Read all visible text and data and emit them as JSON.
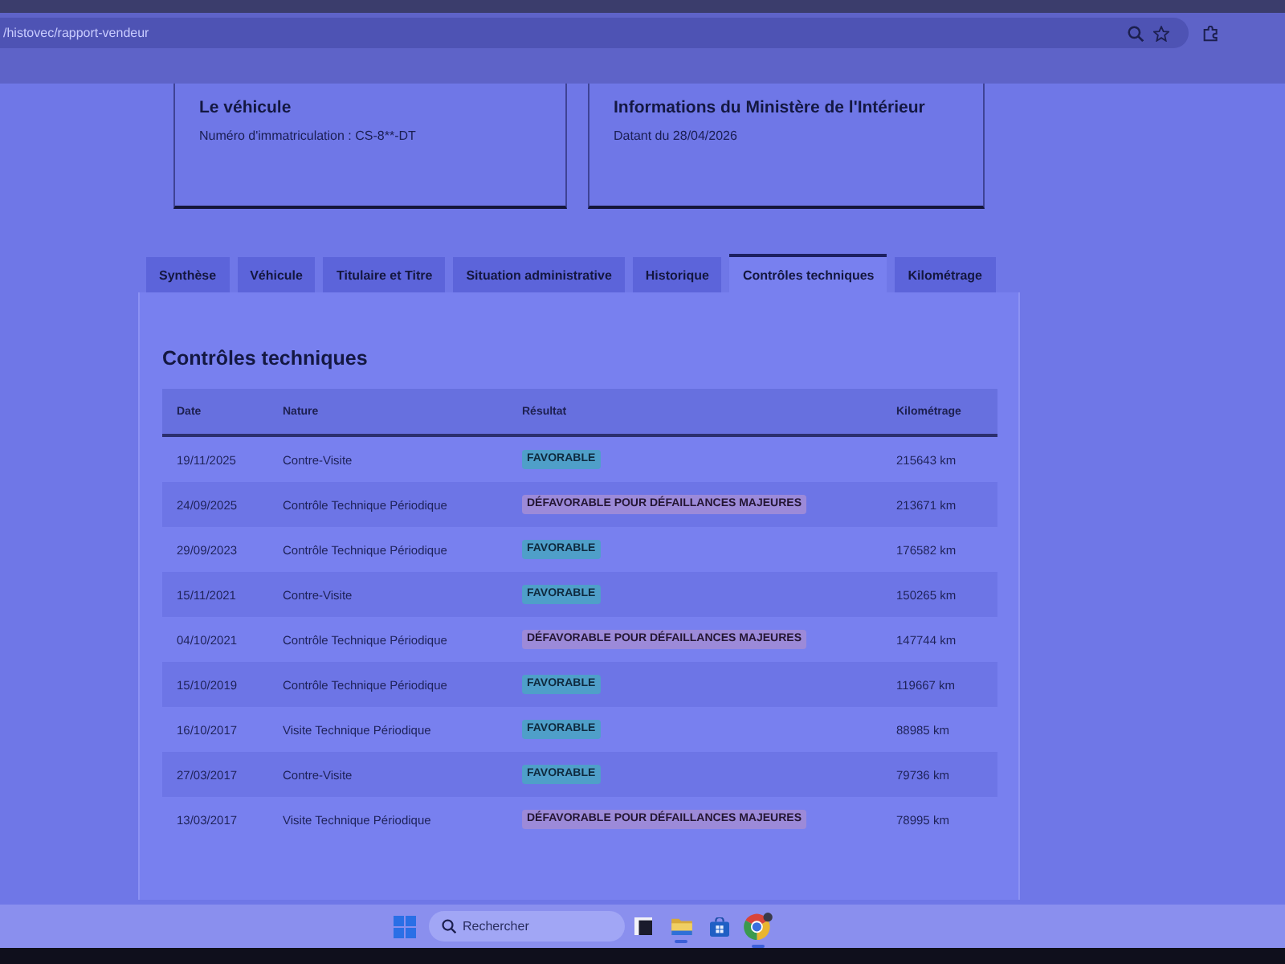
{
  "browser": {
    "url": "/histovec/rapport-vendeur"
  },
  "cards": [
    {
      "title": "Le véhicule",
      "text": "Numéro d'immatriculation : CS-8**-DT"
    },
    {
      "title": "Informations du Ministère de l'Intérieur",
      "text": "Datant du 28/04/2026"
    }
  ],
  "tabs": [
    {
      "label": "Synthèse",
      "selected": false
    },
    {
      "label": "Véhicule",
      "selected": false
    },
    {
      "label": "Titulaire et Titre",
      "selected": false
    },
    {
      "label": "Situation administrative",
      "selected": false
    },
    {
      "label": "Historique",
      "selected": false
    },
    {
      "label": "Contrôles techniques",
      "selected": true
    },
    {
      "label": "Kilométrage",
      "selected": false
    }
  ],
  "section": {
    "title": "Contrôles techniques"
  },
  "table": {
    "columns": [
      "Date",
      "Nature",
      "Résultat",
      "Kilométrage"
    ],
    "rows": [
      {
        "date": "19/11/2025",
        "nature": "Contre-Visite",
        "result": {
          "kind": "favorable",
          "label": "FAVORABLE"
        },
        "mileage": "215643 km"
      },
      {
        "date": "24/09/2025",
        "nature": "Contrôle Technique Périodique",
        "result": {
          "kind": "unfavorable",
          "label": "DÉFAVORABLE POUR DÉFAILLANCES MAJEURES"
        },
        "mileage": "213671 km"
      },
      {
        "date": "29/09/2023",
        "nature": "Contrôle Technique Périodique",
        "result": {
          "kind": "favorable",
          "label": "FAVORABLE"
        },
        "mileage": "176582 km"
      },
      {
        "date": "15/11/2021",
        "nature": "Contre-Visite",
        "result": {
          "kind": "favorable",
          "label": "FAVORABLE"
        },
        "mileage": "150265 km"
      },
      {
        "date": "04/10/2021",
        "nature": "Contrôle Technique Périodique",
        "result": {
          "kind": "unfavorable",
          "label": "DÉFAVORABLE POUR DÉFAILLANCES MAJEURES"
        },
        "mileage": "147744 km"
      },
      {
        "date": "15/10/2019",
        "nature": "Contrôle Technique Périodique",
        "result": {
          "kind": "favorable",
          "label": "FAVORABLE"
        },
        "mileage": "119667 km"
      },
      {
        "date": "16/10/2017",
        "nature": "Visite Technique Périodique",
        "result": {
          "kind": "favorable",
          "label": "FAVORABLE"
        },
        "mileage": "88985 km"
      },
      {
        "date": "27/03/2017",
        "nature": "Contre-Visite",
        "result": {
          "kind": "favorable",
          "label": "FAVORABLE"
        },
        "mileage": "79736 km"
      },
      {
        "date": "13/03/2017",
        "nature": "Visite Technique Périodique",
        "result": {
          "kind": "unfavorable",
          "label": "DÉFAVORABLE POUR DÉFAILLANCES MAJEURES"
        },
        "mileage": "78995 km"
      }
    ]
  },
  "taskbar": {
    "search": {
      "placeholder": "Rechercher"
    },
    "apps": [
      {
        "kind": "squares",
        "running": false
      },
      {
        "kind": "folder",
        "running": true
      },
      {
        "kind": "store",
        "running": false
      },
      {
        "kind": "browser",
        "running": true
      }
    ]
  }
}
